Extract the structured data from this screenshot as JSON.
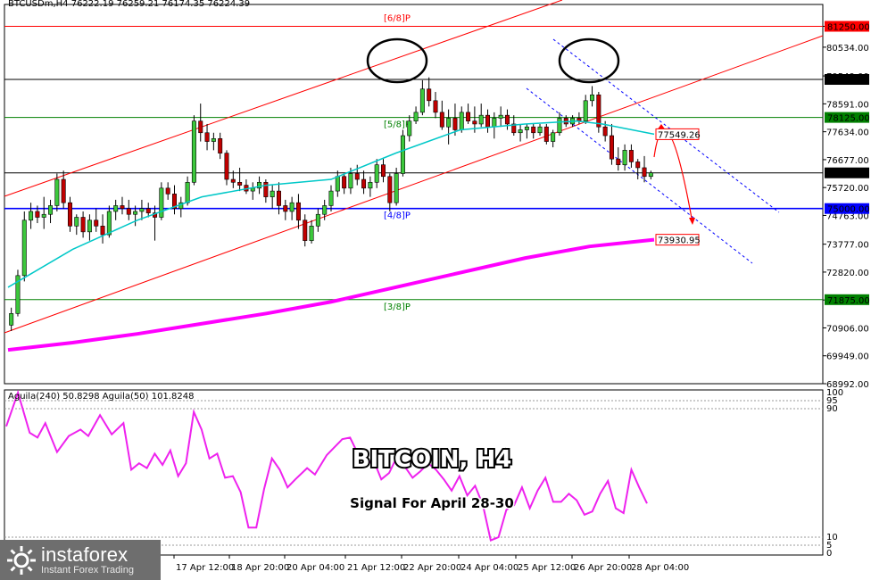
{
  "header": {
    "text": "BTCUSDm,H4  76222.19 76259.21 76174.35 76224.39"
  },
  "chart_data": {
    "type": "candlestick",
    "symbol": "BTCUSDm",
    "timeframe": "H4",
    "ylim": [
      68992,
      82000
    ],
    "yticks": [
      81250.0,
      80534.0,
      79549.0,
      78591.0,
      77634.0,
      76677.0,
      75720.0,
      74763.0,
      73777.0,
      72820.0,
      71863.0,
      70906.0,
      69949.0,
      68992.0
    ],
    "xticks": [
      "17 Apr 12:00",
      "18 Apr 20:00",
      "20 Apr 04:00",
      "21 Apr 12:00",
      "22 Apr 20:00",
      "24 Apr 04:00",
      "25 Apr 12:00",
      "26 Apr 20:00",
      "28 Apr 04:00"
    ],
    "levels": [
      {
        "price": 81250.0,
        "color": "#ff0000",
        "label": "[6/8]P",
        "tag": "81250.00"
      },
      {
        "price": 79428.89,
        "color": "#000000",
        "label": "",
        "tag": "79428.89"
      },
      {
        "price": 78125.0,
        "color": "#008000",
        "label": "[5/8]P",
        "tag": "78125.00"
      },
      {
        "price": 76224.39,
        "color": "#000000",
        "label": "",
        "tag": "76224.39"
      },
      {
        "price": 75000.0,
        "color": "#0000ff",
        "label": "[4/8]P",
        "tag": "75000.00"
      },
      {
        "price": 71875.0,
        "color": "#008000",
        "label": "[3/8]P",
        "tag": "71875.00"
      }
    ],
    "targets": [
      {
        "price": 77549.26,
        "tag": "77549.26"
      },
      {
        "price": 73930.95,
        "tag": "73930.95"
      }
    ],
    "candles": [
      [
        71000,
        71600,
        70800,
        71400
      ],
      [
        71400,
        72900,
        71300,
        72700
      ],
      [
        72700,
        74900,
        72500,
        74600
      ],
      [
        74600,
        75200,
        74300,
        74900
      ],
      [
        74900,
        75100,
        74500,
        74700
      ],
      [
        74700,
        75400,
        74300,
        74800
      ],
      [
        74800,
        75300,
        74500,
        75100
      ],
      [
        75100,
        76200,
        74900,
        76000
      ],
      [
        76000,
        76300,
        75000,
        75200
      ],
      [
        75200,
        75400,
        74200,
        74400
      ],
      [
        74400,
        74800,
        74100,
        74700
      ],
      [
        74700,
        74900,
        74000,
        74200
      ],
      [
        74200,
        74800,
        73900,
        74600
      ],
      [
        74600,
        75000,
        74200,
        74400
      ],
      [
        74400,
        74800,
        73800,
        74100
      ],
      [
        74100,
        75100,
        74000,
        74900
      ],
      [
        74900,
        75300,
        74600,
        75100
      ],
      [
        75100,
        75400,
        74800,
        75000
      ],
      [
        75000,
        75300,
        74600,
        74800
      ],
      [
        74800,
        75100,
        74400,
        74900
      ],
      [
        74900,
        75300,
        74600,
        75000
      ],
      [
        75000,
        75200,
        74700,
        74850
      ],
      [
        74850,
        75100,
        73900,
        74700
      ],
      [
        74700,
        75900,
        74600,
        75700
      ],
      [
        75700,
        75900,
        75300,
        75500
      ],
      [
        75500,
        75800,
        74800,
        75000
      ],
      [
        75000,
        75400,
        74700,
        75200
      ],
      [
        75200,
        76100,
        75100,
        75900
      ],
      [
        75900,
        78200,
        75800,
        78000
      ],
      [
        78000,
        78600,
        77300,
        77600
      ],
      [
        77600,
        77900,
        77000,
        77300
      ],
      [
        77300,
        77600,
        77000,
        77400
      ],
      [
        77400,
        77600,
        76700,
        76900
      ],
      [
        76900,
        77000,
        75800,
        76000
      ],
      [
        76000,
        76300,
        75700,
        75900
      ],
      [
        75900,
        76400,
        75600,
        75800
      ],
      [
        75800,
        76000,
        75500,
        75600
      ],
      [
        75600,
        75900,
        75300,
        75700
      ],
      [
        75700,
        76100,
        75500,
        75900
      ],
      [
        75900,
        76000,
        75200,
        75400
      ],
      [
        75400,
        75800,
        75000,
        75600
      ],
      [
        75600,
        75900,
        74800,
        75100
      ],
      [
        75100,
        75300,
        74600,
        74900
      ],
      [
        74900,
        75400,
        74600,
        75200
      ],
      [
        75200,
        75500,
        74300,
        74600
      ],
      [
        74600,
        74800,
        73700,
        73900
      ],
      [
        73900,
        74600,
        73800,
        74400
      ],
      [
        74400,
        75000,
        74200,
        74800
      ],
      [
        74800,
        75300,
        74600,
        75100
      ],
      [
        75100,
        75800,
        74900,
        75600
      ],
      [
        75600,
        76300,
        75400,
        76100
      ],
      [
        76100,
        76200,
        75500,
        75700
      ],
      [
        75700,
        76400,
        75500,
        76200
      ],
      [
        76200,
        76500,
        75800,
        76000
      ],
      [
        76000,
        76300,
        75500,
        75700
      ],
      [
        75700,
        76100,
        75400,
        75900
      ],
      [
        75900,
        76700,
        75700,
        76500
      ],
      [
        76500,
        76700,
        75900,
        76100
      ],
      [
        76100,
        76200,
        74900,
        75200
      ],
      [
        75200,
        76400,
        75100,
        76200
      ],
      [
        76200,
        77700,
        76100,
        77500
      ],
      [
        77500,
        78200,
        77300,
        78000
      ],
      [
        78000,
        78500,
        77900,
        78300
      ],
      [
        78300,
        79400,
        78200,
        79100
      ],
      [
        79100,
        79500,
        78500,
        78700
      ],
      [
        78700,
        79000,
        78100,
        78300
      ],
      [
        78300,
        78700,
        77700,
        77800
      ],
      [
        77800,
        78400,
        77200,
        78100
      ],
      [
        78100,
        78600,
        77500,
        77700
      ],
      [
        77700,
        78500,
        77600,
        78300
      ],
      [
        78300,
        78600,
        77900,
        78000
      ],
      [
        78000,
        78500,
        77600,
        77900
      ],
      [
        77900,
        78600,
        77800,
        78200
      ],
      [
        78200,
        78400,
        77600,
        77800
      ],
      [
        77800,
        78300,
        77400,
        78100
      ],
      [
        78100,
        78500,
        77800,
        78200
      ],
      [
        78200,
        78400,
        77700,
        77900
      ],
      [
        77900,
        78200,
        77500,
        77600
      ],
      [
        77600,
        77900,
        77300,
        77700
      ],
      [
        77700,
        77900,
        77400,
        77800
      ],
      [
        77800,
        77900,
        77400,
        77600
      ],
      [
        77600,
        77900,
        77500,
        77800
      ],
      [
        77800,
        77900,
        77200,
        77300
      ],
      [
        77300,
        77700,
        77100,
        77600
      ],
      [
        77600,
        78300,
        77500,
        78100
      ],
      [
        78100,
        78200,
        77800,
        77900
      ],
      [
        77900,
        78200,
        77800,
        78100
      ],
      [
        78100,
        78300,
        77900,
        78000
      ],
      [
        78000,
        78900,
        77900,
        78700
      ],
      [
        78700,
        79200,
        78500,
        78900
      ],
      [
        78900,
        79000,
        77600,
        77800
      ],
      [
        77800,
        78000,
        77300,
        77500
      ],
      [
        77500,
        77900,
        76500,
        76700
      ],
      [
        76700,
        77100,
        76300,
        76500
      ],
      [
        76500,
        77200,
        76300,
        77000
      ],
      [
        77000,
        77200,
        76400,
        76600
      ],
      [
        76600,
        76700,
        76000,
        76400
      ],
      [
        76400,
        76800,
        75900,
        76100
      ],
      [
        76100,
        76300,
        76000,
        76224
      ]
    ],
    "series": [
      {
        "name": "",
        "color": "#00c8c8",
        "width": 1.5,
        "values": [
          [
            0,
            72300
          ],
          [
            10,
            73600
          ],
          [
            20,
            74600
          ],
          [
            30,
            75400
          ],
          [
            40,
            75800
          ],
          [
            50,
            76000
          ],
          [
            60,
            76900
          ],
          [
            70,
            77700
          ],
          [
            80,
            77900
          ],
          [
            88,
            78000
          ],
          [
            92,
            77900
          ],
          [
            100,
            77550
          ]
        ]
      },
      {
        "name": "",
        "color": "#ff00ff",
        "width": 4,
        "values": [
          [
            0,
            70150
          ],
          [
            10,
            70400
          ],
          [
            20,
            70700
          ],
          [
            30,
            71050
          ],
          [
            40,
            71400
          ],
          [
            50,
            71800
          ],
          [
            60,
            72300
          ],
          [
            70,
            72800
          ],
          [
            80,
            73300
          ],
          [
            90,
            73700
          ],
          [
            100,
            73930
          ]
        ]
      }
    ],
    "oscillator": {
      "label": "Aguila(240) 50.8298  Aguila(50) 101.8248",
      "ylim": [
        0,
        100
      ],
      "levels": [
        {
          "v": 100,
          "t": "100"
        },
        {
          "v": 95,
          "t": "95"
        },
        {
          "v": 90,
          "t": "90"
        },
        {
          "v": 10,
          "t": "10"
        },
        {
          "v": 5,
          "t": "5"
        },
        {
          "v": 0,
          "t": "0"
        }
      ],
      "values": [
        [
          0,
          79
        ],
        [
          3,
          100
        ],
        [
          6,
          75
        ],
        [
          8,
          72
        ],
        [
          10,
          81
        ],
        [
          13,
          63
        ],
        [
          16,
          73
        ],
        [
          19,
          77
        ],
        [
          21,
          73
        ],
        [
          24,
          86
        ],
        [
          27,
          74
        ],
        [
          30,
          81
        ],
        [
          32,
          52
        ],
        [
          34,
          56
        ],
        [
          36,
          53
        ],
        [
          38,
          62
        ],
        [
          40,
          55
        ],
        [
          42,
          64
        ],
        [
          44,
          48
        ],
        [
          46,
          56
        ],
        [
          48,
          88
        ],
        [
          50,
          77
        ],
        [
          52,
          59
        ],
        [
          54,
          62
        ],
        [
          56,
          47
        ],
        [
          58,
          48
        ],
        [
          60,
          38
        ],
        [
          62,
          16
        ],
        [
          64,
          16
        ],
        [
          66,
          40
        ],
        [
          68,
          59
        ],
        [
          70,
          52
        ],
        [
          72,
          41
        ],
        [
          74,
          46
        ],
        [
          77,
          53
        ],
        [
          79,
          49
        ],
        [
          82,
          61
        ],
        [
          84,
          66
        ],
        [
          86,
          71
        ],
        [
          88,
          72
        ],
        [
          90,
          62
        ],
        [
          92,
          55
        ],
        [
          94,
          58
        ],
        [
          96,
          46
        ],
        [
          98,
          50
        ],
        [
          100,
          60
        ],
        [
          102,
          54
        ],
        [
          104,
          47
        ],
        [
          106,
          51
        ],
        [
          108,
          56
        ],
        [
          110,
          52
        ],
        [
          112,
          46
        ],
        [
          114,
          39
        ],
        [
          116,
          48
        ],
        [
          118,
          36
        ],
        [
          120,
          42
        ],
        [
          122,
          30
        ],
        [
          124,
          8
        ],
        [
          126,
          10
        ],
        [
          128,
          27
        ],
        [
          130,
          30
        ],
        [
          132,
          41
        ],
        [
          134,
          28
        ],
        [
          136,
          39
        ],
        [
          138,
          47
        ],
        [
          140,
          32
        ],
        [
          142,
          32
        ],
        [
          144,
          37
        ],
        [
          146,
          33
        ],
        [
          148,
          24
        ],
        [
          150,
          26
        ],
        [
          152,
          37
        ],
        [
          154,
          45
        ],
        [
          156,
          28
        ],
        [
          158,
          25
        ],
        [
          160,
          52
        ],
        [
          162,
          41
        ],
        [
          164,
          31
        ]
      ]
    }
  },
  "overlay": {
    "title": "BITCOIN, H4",
    "subtitle": "Signal For April 28-30"
  },
  "logo": {
    "brand": "instaforex",
    "tagline": "Instant Forex Trading"
  }
}
